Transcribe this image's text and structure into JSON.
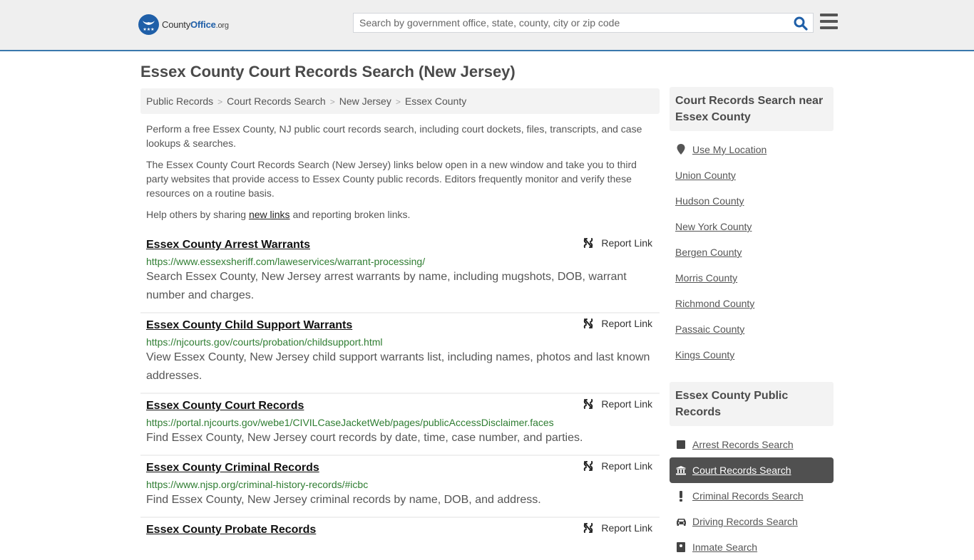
{
  "header": {
    "logo": {
      "name_part1": "County",
      "name_part2": "Office",
      "name_suffix": ".org"
    },
    "search": {
      "placeholder": "Search by government office, state, county, city or zip code",
      "value": ""
    },
    "colors": {
      "brand": "#1f5fa8",
      "header_border": "#3a78ad"
    }
  },
  "page": {
    "title": "Essex County Court Records Search (New Jersey)",
    "breadcrumb": [
      "Public Records",
      "Court Records Search",
      "New Jersey",
      "Essex County"
    ],
    "intro": {
      "p1": "Perform a free Essex County, NJ public court records search, including court dockets, files, transcripts, and case lookups & searches.",
      "p2": "The Essex County Court Records Search (New Jersey) links below open in a new window and take you to third party websites that provide access to Essex County public records. Editors frequently monitor and verify these resources on a routine basis.",
      "p3_before": "Help others by sharing ",
      "p3_link": "new links",
      "p3_after": " and reporting broken links."
    },
    "report_label": "Report Link",
    "results": [
      {
        "title": "Essex County Arrest Warrants",
        "url": "https://www.essexsheriff.com/laweservices/warrant-processing/",
        "desc": "Search Essex County, New Jersey arrest warrants by name, including mugshots, DOB, warrant number and charges."
      },
      {
        "title": "Essex County Child Support Warrants",
        "url": "https://njcourts.gov/courts/probation/childsupport.html",
        "desc": "View Essex County, New Jersey child support warrants list, including names, photos and last known addresses."
      },
      {
        "title": "Essex County Court Records",
        "url": "https://portal.njcourts.gov/webe1/CIVILCaseJacketWeb/pages/publicAccessDisclaimer.faces",
        "desc": "Find Essex County, New Jersey court records by date, time, case number, and parties."
      },
      {
        "title": "Essex County Criminal Records",
        "url": "https://www.njsp.org/criminal-history-records/#icbc",
        "desc": "Find Essex County, New Jersey criminal records by name, DOB, and address."
      },
      {
        "title": "Essex County Probate Records",
        "url": "",
        "desc": ""
      }
    ]
  },
  "sidebar": {
    "nearby_heading": "Court Records Search near Essex County",
    "use_location": "Use My Location",
    "nearby": [
      "Union County",
      "Hudson County",
      "New York County",
      "Bergen County",
      "Morris County",
      "Richmond County",
      "Passaic County",
      "Kings County"
    ],
    "public_heading": "Essex County Public Records",
    "public_records": [
      {
        "label": "Arrest Records Search",
        "icon": "square-icon",
        "active": false
      },
      {
        "label": "Court Records Search",
        "icon": "courthouse-icon",
        "active": true
      },
      {
        "label": "Criminal Records Search",
        "icon": "exclamation-icon",
        "active": false
      },
      {
        "label": "Driving Records Search",
        "icon": "car-icon",
        "active": false
      },
      {
        "label": "Inmate Search",
        "icon": "inmate-icon",
        "active": false
      }
    ]
  }
}
